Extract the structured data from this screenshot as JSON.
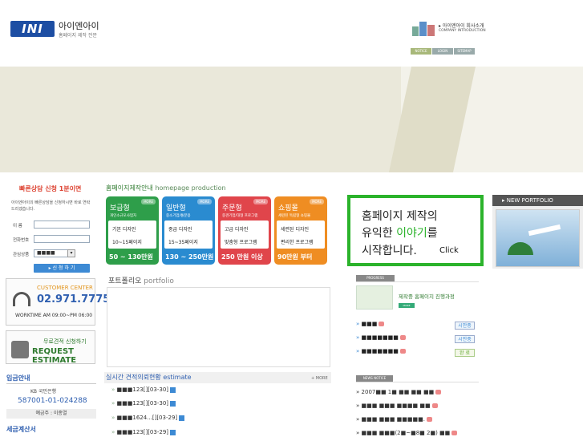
{
  "header": {
    "logo_text": "INI",
    "brand_name": "아이엔아이",
    "brand_tagline": "홈페이지 제작 전문",
    "company_link": "▸ 아이엔아이 회사소개",
    "company_link_en": "COMPANY INTRODUCTION",
    "topnav": [
      "NOTICE",
      "LOGIN",
      "SITEMAP"
    ]
  },
  "quick_consult": {
    "title": "빠른상담 신청 1분이면",
    "description": "아이엔아이의 빠른상담을 신청하시면 바로 연락드리겠습니다.",
    "fields": [
      {
        "label": "이    름",
        "value": ""
      },
      {
        "label": "전화번호",
        "value": ""
      },
      {
        "label": "관심상품",
        "value": "■■■■"
      }
    ],
    "submit_label": "▸ 신 청 하 기"
  },
  "customer_center": {
    "title": "CUSTOMER CENTER",
    "phone": "02.971.7775",
    "hours": "WORKTIME AM 09:00~PM 06:00"
  },
  "request_estimate": {
    "line1": "무료견적 신청하기",
    "line2": "REQUEST ESTIMATE"
  },
  "deposit": {
    "title": "입금안내",
    "bank": "KB  국민은행",
    "account": "587001-01-024288",
    "holder": "예금주 : 이종열"
  },
  "tax": {
    "title": "세금계산서"
  },
  "production": {
    "title_ko": "홈페이지제작안내",
    "title_en": "homepage production",
    "packages": [
      {
        "name": "보급형",
        "more": "MORE",
        "desc": "개인소규모사업자",
        "line1": "기본 디자인",
        "line2": "10~15페이지",
        "price": "50 ~ 130만원",
        "color": "#2e9e4a"
      },
      {
        "name": "일반형",
        "more": "MORE",
        "desc": "중소기업/통분용",
        "line1": "중급 디자인",
        "line2": "15~35페이지",
        "price": "130 ~ 250만원",
        "color": "#2a8bd0"
      },
      {
        "name": "주문형",
        "more": "MORE",
        "desc": "중견기업/대형 프로그램",
        "line1": "고급 디자인",
        "line2": "맞춤형 프로그램",
        "price": "250 만원 이상",
        "color": "#e0454b"
      },
      {
        "name": "쇼핑몰",
        "more": "MORE",
        "desc": "세련된 독립형 쇼핑몰",
        "line1": "세련된 디자인",
        "line2": "편리한 프로그램",
        "price": "90만원 부터",
        "color": "#ef8d22"
      }
    ]
  },
  "portfolio": {
    "title_ko": "포트폴리오",
    "title_en": "portfolio"
  },
  "estimate": {
    "title_ko": "실시간 견적의뢰현황",
    "title_en": "estimate",
    "more": "+ MORE",
    "items": [
      {
        "text": "■■■123[][03-30]"
      },
      {
        "text": "■■■123[][03-30]"
      },
      {
        "text": "■■■1624...[][03-29]"
      },
      {
        "text": "■■■123[][03-29]"
      }
    ]
  },
  "promo": {
    "line1": "홈페이지 제작의",
    "line2_a": "유익한 ",
    "line2_b": "이야기",
    "line2_c": "를",
    "line3": "시작합니다.",
    "click": "Click"
  },
  "new_portfolio": {
    "title": "▸ NEW PORTFOLIO"
  },
  "progress": {
    "header": "PROGRESS",
    "headline": "제작중 홈페이지 진행과정",
    "btn": "MORE",
    "items": [
      {
        "text": "■■■",
        "status": "시안중"
      },
      {
        "text": "■■■■■■■",
        "status": "시안중"
      },
      {
        "text": "■■■■■■■",
        "status": "완 료"
      }
    ]
  },
  "news": {
    "header": "NEWS NOTICE",
    "items": [
      {
        "text": "2007■■ 1■ ■■ ■■ ■■"
      },
      {
        "text": "■■■ ■■■ ■■■■ ■■"
      },
      {
        "text": "■■■ ■■■ ■■■■■."
      },
      {
        "text": "■■■ ■■■(2■~■8■ 2■) ■■"
      }
    ]
  }
}
